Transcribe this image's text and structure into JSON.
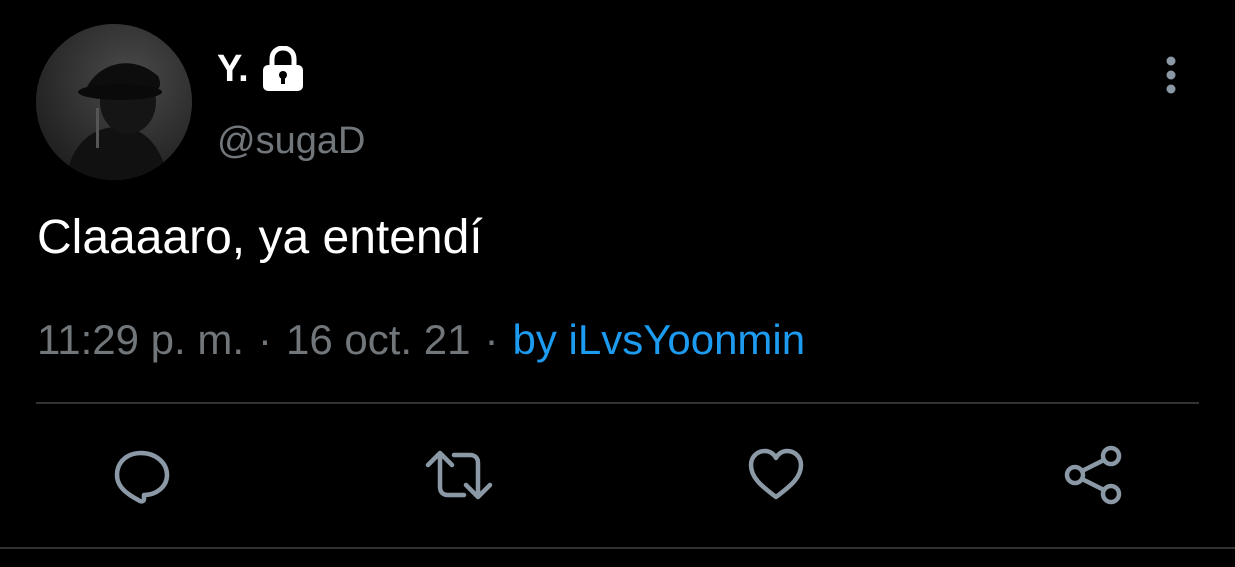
{
  "user": {
    "display_name": "Y.",
    "handle": "@sugaD",
    "protected_icon": "lock-icon",
    "avatar_icon": "avatar"
  },
  "tweet": {
    "text": "Claaaaro, ya entendí",
    "time": "11:29 p. m.",
    "separator": "·",
    "date": "16 oct. 21",
    "source": "by iLvsYoonmin"
  },
  "actions": [
    {
      "name": "reply",
      "icon": "comment-icon"
    },
    {
      "name": "retweet",
      "icon": "retweet-icon"
    },
    {
      "name": "like",
      "icon": "heart-icon"
    },
    {
      "name": "share",
      "icon": "share-icon"
    }
  ],
  "colors": {
    "background": "#000000",
    "primary_text": "#ffffff",
    "secondary_text": "#71767b",
    "link": "#1d9bf0",
    "icon": "#8b98a5",
    "divider": "#2f3336"
  }
}
